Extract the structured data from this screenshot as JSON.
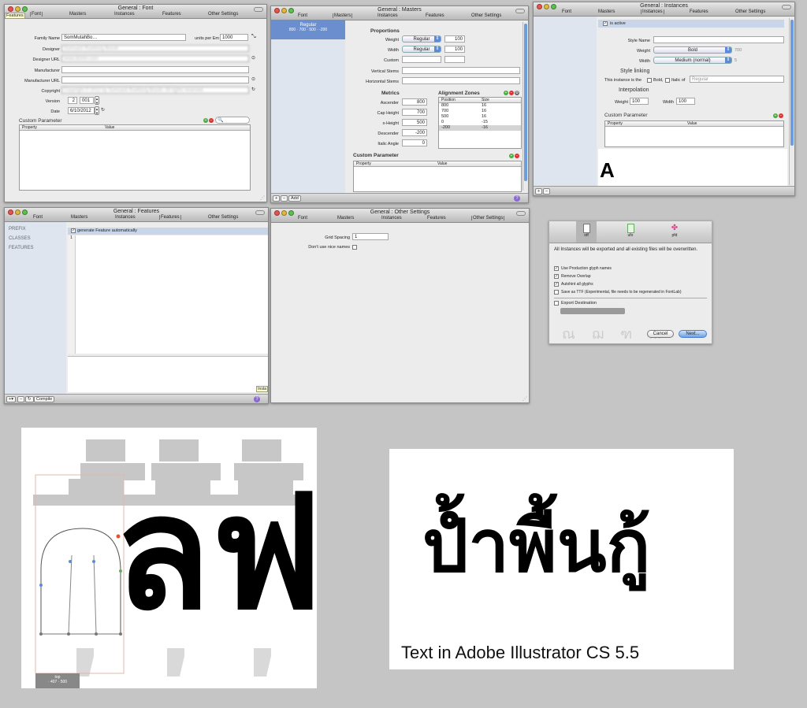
{
  "tabs_common": [
    "General",
    "Font",
    "Masters",
    "Instances",
    "Features",
    "Other Settings"
  ],
  "font_window": {
    "title": "General : Font",
    "tooltip": "Features",
    "labels": {
      "family": "Family Name",
      "upm": "units per Em",
      "designer": "Designer",
      "designer_url": "Designer URL",
      "manufacturer": "Manufacturer",
      "manufacturer_url": "Manufacturer URL",
      "copyright": "Copyright",
      "version": "Version",
      "date": "Date"
    },
    "values": {
      "family": "SomMutahBo…",
      "upm": "1000",
      "designer": "Somsack Ruettong Bossh",
      "designer_url": "www.domin.com",
      "copyright": "Copyright © 2012 by Somsack Ruettong Bossh. All rights reserved.",
      "version_major": "2",
      "version_minor": "001",
      "date": "6/10/2012"
    },
    "custom_parameter": "Custom Parameter",
    "col_property": "Property",
    "col_value": "Value"
  },
  "masters_window": {
    "title": "General : Masters",
    "master_name": "Regular",
    "master_values": "800 · 700 · 500 · -200",
    "proportions": "Proportions",
    "weight_label": "Weight",
    "weight_value": "Regular",
    "weight_num": "100",
    "width_label": "Width",
    "width_value": "Regular",
    "width_num": "100",
    "custom_label": "Custom",
    "vstems": "Vertical Stems",
    "hstems": "Horizontal Stems",
    "metrics": "Metrics",
    "ascender": "Ascender",
    "ascender_v": "800",
    "cap": "Cap Height",
    "cap_v": "700",
    "xheight": "x-Height",
    "xheight_v": "500",
    "descender": "Descender",
    "descender_v": "-200",
    "italic": "Italic Angle",
    "italic_v": "0",
    "alignment_zones": "Alignment Zones",
    "az_position": "Position",
    "az_size": "Size",
    "zones": [
      [
        "800",
        "16"
      ],
      [
        "700",
        "16"
      ],
      [
        "500",
        "16"
      ],
      [
        "0",
        "-15"
      ],
      [
        "-200",
        "-16"
      ]
    ],
    "custom_parameter": "Custom Parameter",
    "col_property": "Property",
    "col_value": "Value",
    "add": "Add"
  },
  "instances_window": {
    "title": "General : Instances",
    "is_active": "is active",
    "style_name": "Style Name",
    "weight_label": "Weight",
    "weight_value": "Bold",
    "weight_num": "700",
    "width_label": "Width",
    "width_value": "Medium (normal)",
    "width_num": "5",
    "style_linking": "Style linking",
    "this_instance": "This instance is the",
    "bold_of": "Bold,",
    "italic_of": "Italic of",
    "regular_placeholder": "Regular",
    "interpolation": "Interpolation",
    "interp_weight": "Weight",
    "interp_weight_v": "100",
    "interp_width": "Width",
    "interp_width_v": "100",
    "custom_parameter": "Custom Parameter",
    "col_property": "Property",
    "col_value": "Value",
    "preview_glyph": "A"
  },
  "features_window": {
    "title": "General : Features",
    "sidebar": [
      "PREFIX",
      "CLASSES",
      "FEATURES"
    ],
    "generate": "generate Feature automatically",
    "line_no": "1",
    "compile": "Compile",
    "tooltip": "Insta"
  },
  "other_window": {
    "title": "General : Other Settings",
    "grid_spacing": "Grid Spacing",
    "grid_value": "1",
    "nice_names": "Don't use nice names"
  },
  "export_dialog": {
    "formats": [
      "otf",
      "ufo",
      "pfd"
    ],
    "message": "All Instances will be exported and all existing files will be overwritten.",
    "options": [
      {
        "label": "Use Production glyph names",
        "checked": true
      },
      {
        "label": "Remove Overlap",
        "checked": true
      },
      {
        "label": "Autohint all glyphs",
        "checked": true
      },
      {
        "label": "Save as TTF (Experimental, file needs to be regenerated in FontLab)",
        "checked": false
      }
    ],
    "export_destination": "Export Destination",
    "cancel": "Cancel",
    "next": "Next..."
  },
  "glyph_editor": {
    "big_glyphs": "ลฟ",
    "tooltip_title": "top",
    "tooltip_values": "· 407   · 500"
  },
  "illustrator_sample": {
    "thai_text": "ป้ำพื้นกู้",
    "caption": "Text in Adobe Illustrator CS 5.5"
  }
}
